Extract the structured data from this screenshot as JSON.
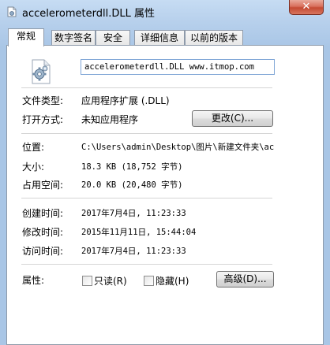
{
  "window": {
    "title": "accelerometerdll.DLL 属性",
    "close_glyph": "✕"
  },
  "tabs": [
    {
      "label": "常规",
      "active": true
    },
    {
      "label": "数字签名",
      "active": false
    },
    {
      "label": "安全",
      "active": false
    },
    {
      "label": "详细信息",
      "active": false
    },
    {
      "label": "以前的版本",
      "active": false
    }
  ],
  "general": {
    "file_icon": "dll-gear-file-icon",
    "filename": "accelerometerdll.DLL www.itmop.com",
    "file_type_label": "文件类型:",
    "file_type_value": "应用程序扩展 (.DLL)",
    "open_with_label": "打开方式:",
    "open_with_value": "未知应用程序",
    "change_button": "更改(C)...",
    "location_label": "位置:",
    "location_value": "C:\\Users\\admin\\Desktop\\图片\\新建文件夹\\ac",
    "size_label": "大小:",
    "size_value": "18.3 KB (18,752 字节)",
    "size_on_disk_label": "占用空间:",
    "size_on_disk_value": "20.0 KB (20,480 字节)",
    "created_label": "创建时间:",
    "created_value": "2017年7月4日, 11:23:33",
    "modified_label": "修改时间:",
    "modified_value": "2015年11月11日, 15:44:04",
    "accessed_label": "访问时间:",
    "accessed_value": "2017年7月4日, 11:23:33",
    "attributes_label": "属性:",
    "readonly_label": "只读(R)",
    "readonly_checked": false,
    "hidden_label": "隐藏(H)",
    "hidden_checked": false,
    "advanced_button": "高级(D)..."
  }
}
